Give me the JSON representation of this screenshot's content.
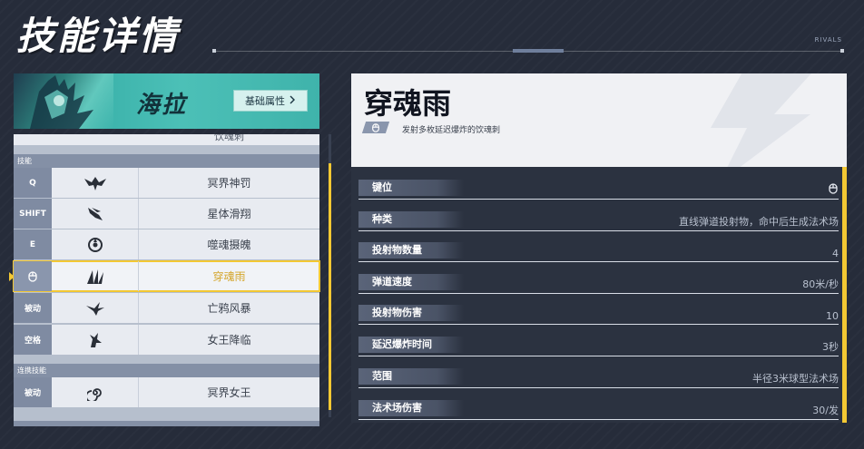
{
  "header": {
    "title": "技能详情",
    "brand_tag": "RIVALS"
  },
  "hero": {
    "name": "海拉",
    "base_attributes_button": "基础属性"
  },
  "skills_panel": {
    "partial_row_name": "饮魂刺",
    "sections": [
      {
        "label": "技能",
        "items": [
          {
            "key": "Q",
            "icon": "raven-wings-icon",
            "name": "冥界神罚",
            "selected": false
          },
          {
            "key": "SHIFT",
            "icon": "dash-feather-icon",
            "name": "星体滑翔",
            "selected": false
          },
          {
            "key": "E",
            "icon": "soul-orb-icon",
            "name": "噬魂摄魄",
            "selected": false
          },
          {
            "key": "",
            "icon": "claw-spikes-icon",
            "name": "穿魂雨",
            "selected": true
          },
          {
            "key": "被动",
            "icon": "raven-icon",
            "name": "亡鸦风暴",
            "selected": false
          },
          {
            "key": "空格",
            "icon": "raven-rise-icon",
            "name": "女王降临",
            "selected": false
          }
        ]
      },
      {
        "label": "连携技能",
        "items": [
          {
            "key": "被动",
            "icon": "spiral-icon",
            "name": "冥界女王",
            "selected": false
          }
        ]
      }
    ]
  },
  "detail": {
    "title": "穿魂雨",
    "description": "发射多枚延迟爆炸的饮魂刺",
    "attributes": [
      {
        "label": "键位",
        "value": "",
        "value_icon": "mouse-button-icon"
      },
      {
        "label": "种类",
        "value": "直线弹道投射物，命中后生成法术场"
      },
      {
        "label": "投射物数量",
        "value": "4"
      },
      {
        "label": "弹道速度",
        "value": "80米/秒"
      },
      {
        "label": "投射物伤害",
        "value": "10"
      },
      {
        "label": "延迟爆炸时间",
        "value": "3秒"
      },
      {
        "label": "范围",
        "value": "半径3米球型法术场"
      },
      {
        "label": "法术场伤害",
        "value": "30/发"
      }
    ]
  },
  "colors": {
    "accent": "#f3c833",
    "background": "#262c3a",
    "hero_banner": "#3fb3ab",
    "selected_text": "#d4a52a"
  }
}
